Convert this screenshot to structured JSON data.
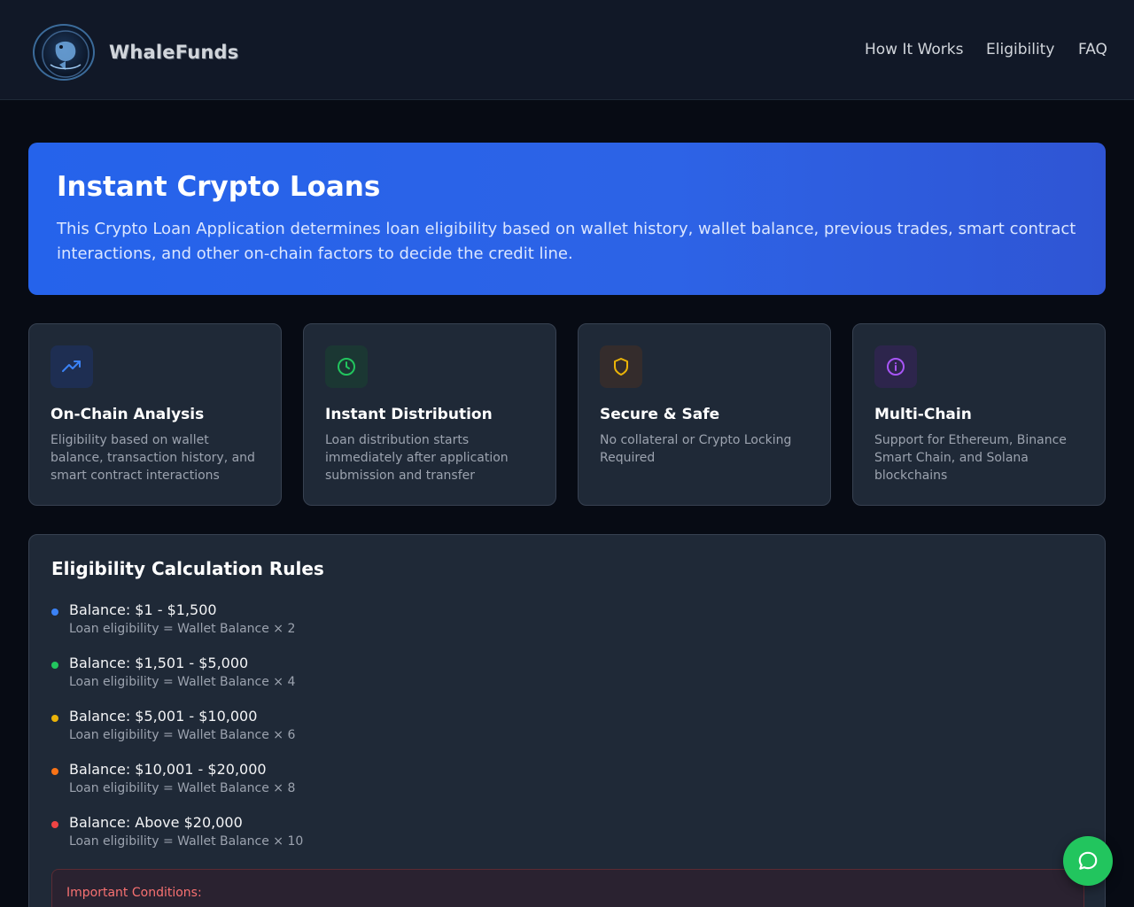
{
  "brand": {
    "name": "WhaleFunds",
    "logo_icon": "whale-icon"
  },
  "nav": {
    "items": [
      "How It Works",
      "Eligibility",
      "FAQ"
    ]
  },
  "hero": {
    "title": "Instant Crypto Loans",
    "description": "This Crypto Loan Application determines loan eligibility based on wallet history, wallet balance, previous trades, smart contract interactions, and other on-chain factors to decide the credit line."
  },
  "features": [
    {
      "icon": "trending-up-icon",
      "color": "#3b82f6",
      "title": "On-Chain Analysis",
      "text": "Eligibility based on wallet balance, transaction history, and smart contract interactions"
    },
    {
      "icon": "clock-icon",
      "color": "#22c55e",
      "title": "Instant Distribution",
      "text": "Loan distribution starts immediately after application submission and transfer"
    },
    {
      "icon": "shield-icon",
      "color": "#eab308",
      "title": "Secure & Safe",
      "text": "No collateral or Crypto Locking Required"
    },
    {
      "icon": "info-icon",
      "color": "#a855f7",
      "title": "Multi-Chain",
      "text": "Support for Ethereum, Binance Smart Chain, and Solana blockchains"
    }
  ],
  "rules": {
    "title": "Eligibility Calculation Rules",
    "items": [
      {
        "color": "#3b82f6",
        "title": "Balance: $1 - $1,500",
        "formula": "Loan eligibility = Wallet Balance × 2"
      },
      {
        "color": "#22c55e",
        "title": "Balance: $1,501 - $5,000",
        "formula": "Loan eligibility = Wallet Balance × 4"
      },
      {
        "color": "#eab308",
        "title": "Balance: $5,001 - $10,000",
        "formula": "Loan eligibility = Wallet Balance × 6"
      },
      {
        "color": "#f97316",
        "title": "Balance: $10,001 - $20,000",
        "formula": "Loan eligibility = Wallet Balance × 8"
      },
      {
        "color": "#ef4444",
        "title": "Balance: Above $20,000",
        "formula": "Loan eligibility = Wallet Balance × 10"
      }
    ],
    "conditions_label": "Important Conditions:"
  },
  "chat": {
    "icon": "chat-icon",
    "color": "#22c55e"
  }
}
